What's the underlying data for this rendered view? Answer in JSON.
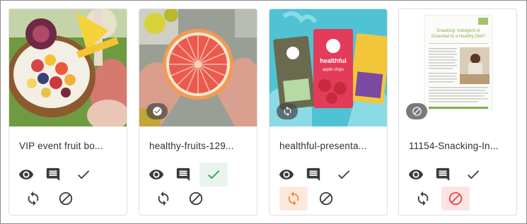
{
  "colors": {
    "icon_default": "#3a3a3a",
    "approved": "#2e9e4f",
    "approved_bg": "#e9f5ec",
    "rework": "#f08a3c",
    "rework_bg": "#fde8dd",
    "rejected": "#e5484d",
    "rejected_bg": "#fde4e4"
  },
  "assets": [
    {
      "name": "VIP event fruit bo...",
      "badge": null,
      "status": "none"
    },
    {
      "name": "healthy-fruits-129...",
      "badge": "check-circle-icon",
      "status": "approved"
    },
    {
      "name": "healthful-presenta...",
      "badge": "sync-icon",
      "status": "rework"
    },
    {
      "name": "11154-Snacking-In...",
      "badge": "block-icon",
      "status": "rejected"
    }
  ],
  "document_thumb": {
    "title_line_1": "Snacking: Indulgent or",
    "title_line_2": "Essential to a Healthy Diet?"
  },
  "product_thumb": {
    "brand": "healthful",
    "flavor": "apple chips"
  }
}
